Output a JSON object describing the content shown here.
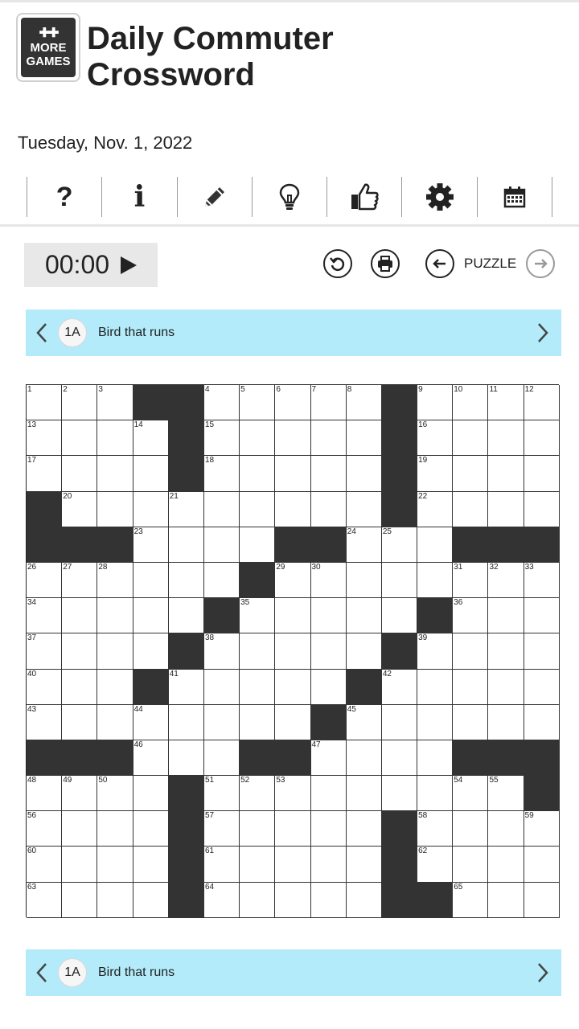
{
  "header": {
    "more_games_line1": "MORE",
    "more_games_line2": "GAMES",
    "title_line1": "Daily Commuter",
    "title_line2": "Crossword",
    "date": "Tuesday, Nov. 1, 2022"
  },
  "toolbar": {
    "items": [
      {
        "icon": "help-icon",
        "glyph": "?"
      },
      {
        "icon": "info-icon",
        "glyph": "i"
      },
      {
        "icon": "pencil-icon"
      },
      {
        "icon": "lightbulb-icon"
      },
      {
        "icon": "thumbs-up-icon"
      },
      {
        "icon": "gear-icon"
      },
      {
        "icon": "calendar-icon"
      }
    ]
  },
  "timer": {
    "value": "00:00"
  },
  "controls": {
    "puzzle_label": "PUZZLE"
  },
  "clue": {
    "number": "1A",
    "text": "Bird that runs"
  },
  "grid": {
    "size": 15,
    "rows": [
      "...##....#....",
      "....#.....#....",
      "....#.....#....",
      "#.........#....",
      "####....##...###",
      "......#.......",
      ".....#......#...",
      "....#......#....",
      "...#.....#.....",
      ".........#.....",
      "###....##......###",
      "....#.........#",
      "....#......#....",
      "....#......#....",
      "....#......##..."
    ],
    "numbers": [
      [
        "1",
        "2",
        "3",
        "",
        "",
        "4",
        "5",
        "6",
        "7",
        "8",
        "",
        "9",
        "10",
        "11",
        "12"
      ],
      [
        "13",
        "",
        "",
        "14",
        "",
        "15",
        "",
        "",
        "",
        "",
        "",
        "16",
        "",
        "",
        ""
      ],
      [
        "17",
        "",
        "",
        "",
        "",
        "18",
        "",
        "",
        "",
        "",
        "",
        "19",
        "",
        "",
        ""
      ],
      [
        "",
        "20",
        "",
        "",
        "21",
        "",
        "",
        "",
        "",
        "",
        "",
        "22",
        "",
        "",
        ""
      ],
      [
        "",
        "",
        "",
        "23",
        "",
        "",
        "",
        "",
        "",
        "24",
        "25",
        "",
        "",
        "",
        ""
      ],
      [
        "26",
        "27",
        "28",
        "",
        "",
        "",
        "",
        "29",
        "30",
        "",
        "",
        "",
        "31",
        "32",
        "33"
      ],
      [
        "34",
        "",
        "",
        "",
        "",
        "",
        "35",
        "",
        "",
        "",
        "",
        "",
        "36",
        "",
        ""
      ],
      [
        "37",
        "",
        "",
        "",
        "",
        "38",
        "",
        "",
        "",
        "",
        "",
        "39",
        "",
        "",
        ""
      ],
      [
        "40",
        "",
        "",
        "",
        "41",
        "",
        "",
        "",
        "",
        "",
        "42",
        "",
        "",
        "",
        ""
      ],
      [
        "43",
        "",
        "",
        "44",
        "",
        "",
        "",
        "",
        "",
        "45",
        "",
        "",
        "",
        "",
        ""
      ],
      [
        "",
        "",
        "",
        "46",
        "",
        "",
        "",
        "",
        "47",
        "",
        "",
        "",
        "",
        "",
        ""
      ],
      [
        "48",
        "49",
        "50",
        "",
        "",
        "51",
        "52",
        "53",
        "",
        "",
        "",
        "",
        "54",
        "55",
        ""
      ],
      [
        "56",
        "",
        "",
        "",
        "",
        "57",
        "",
        "",
        "",
        "",
        "",
        "58",
        "",
        "",
        "59"
      ],
      [
        "60",
        "",
        "",
        "",
        "",
        "61",
        "",
        "",
        "",
        "",
        "",
        "62",
        "",
        "",
        ""
      ],
      [
        "63",
        "",
        "",
        "",
        "",
        "64",
        "",
        "",
        "",
        "",
        "",
        "",
        "65",
        "",
        ""
      ]
    ]
  }
}
